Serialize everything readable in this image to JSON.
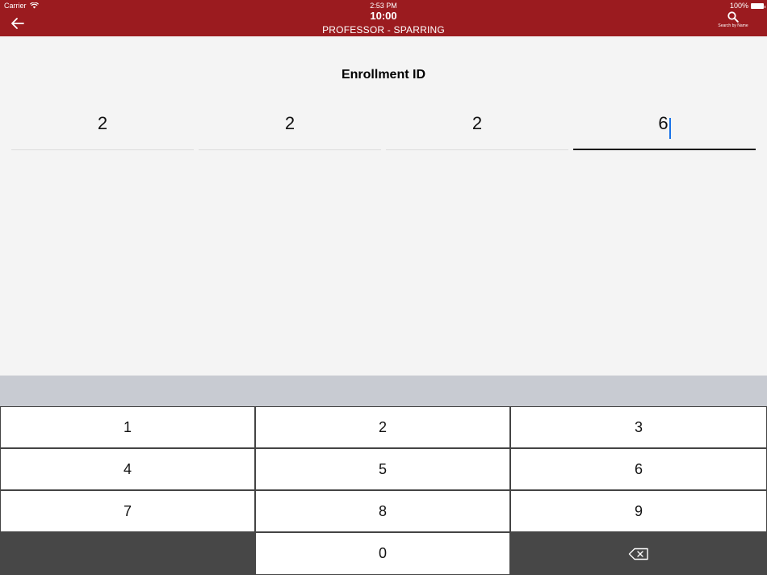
{
  "status_bar": {
    "carrier": "Carrier",
    "clock": "2:53 PM",
    "battery": "100%"
  },
  "header": {
    "title": "10:00",
    "subtitle": "PROFESSOR - SPARRING",
    "search_label": "Search by Name"
  },
  "enrollment": {
    "label": "Enrollment ID",
    "digits": [
      "2",
      "2",
      "2",
      "6"
    ]
  },
  "keypad": {
    "keys": [
      "1",
      "2",
      "3",
      "4",
      "5",
      "6",
      "7",
      "8",
      "9",
      "0"
    ]
  },
  "colors": {
    "header": "#9b1b1f",
    "cursor": "#1a73e8"
  }
}
